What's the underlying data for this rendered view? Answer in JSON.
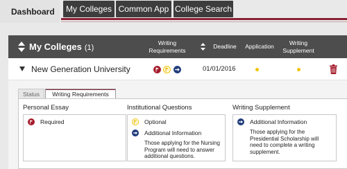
{
  "nav": {
    "dashboard": "Dashboard",
    "buttons": [
      "My Colleges",
      "Common App",
      "College Search"
    ]
  },
  "panel": {
    "title": "My Colleges",
    "count": "(1)",
    "columns": {
      "writing_requirements": [
        "Writing",
        "Requirements"
      ],
      "deadline": "Deadline",
      "application": "Application",
      "writing_supplement": [
        "Writing",
        "Supplement"
      ]
    }
  },
  "university": {
    "name": "New Generation University",
    "deadline": "01/01/2016",
    "application_status": "pending",
    "writing_supplement_status": "pending"
  },
  "tabs": [
    "Status",
    "Writing Requirements"
  ],
  "requirements": {
    "personal_essay": {
      "title": "Personal Essay",
      "items": [
        "Required"
      ]
    },
    "institutional_questions": {
      "title": "Institutional Questions",
      "items": [
        "Optional",
        "Additional Information"
      ],
      "note": [
        "Those applying for the Nursing",
        "Program will need to answer",
        "additional questions."
      ]
    },
    "writing_supplement": {
      "title": "Writing Supplement",
      "items": [
        "Additional Information"
      ],
      "note": [
        "Those applying for the",
        "Presidential Scholarship will",
        "need to complete a writing",
        "supplement."
      ]
    }
  },
  "colors": {
    "accent": "#8b2236",
    "header": "#4d4d4d",
    "required": "#a51d2d",
    "optional": "#f2c200",
    "info": "#1f3b7a"
  }
}
